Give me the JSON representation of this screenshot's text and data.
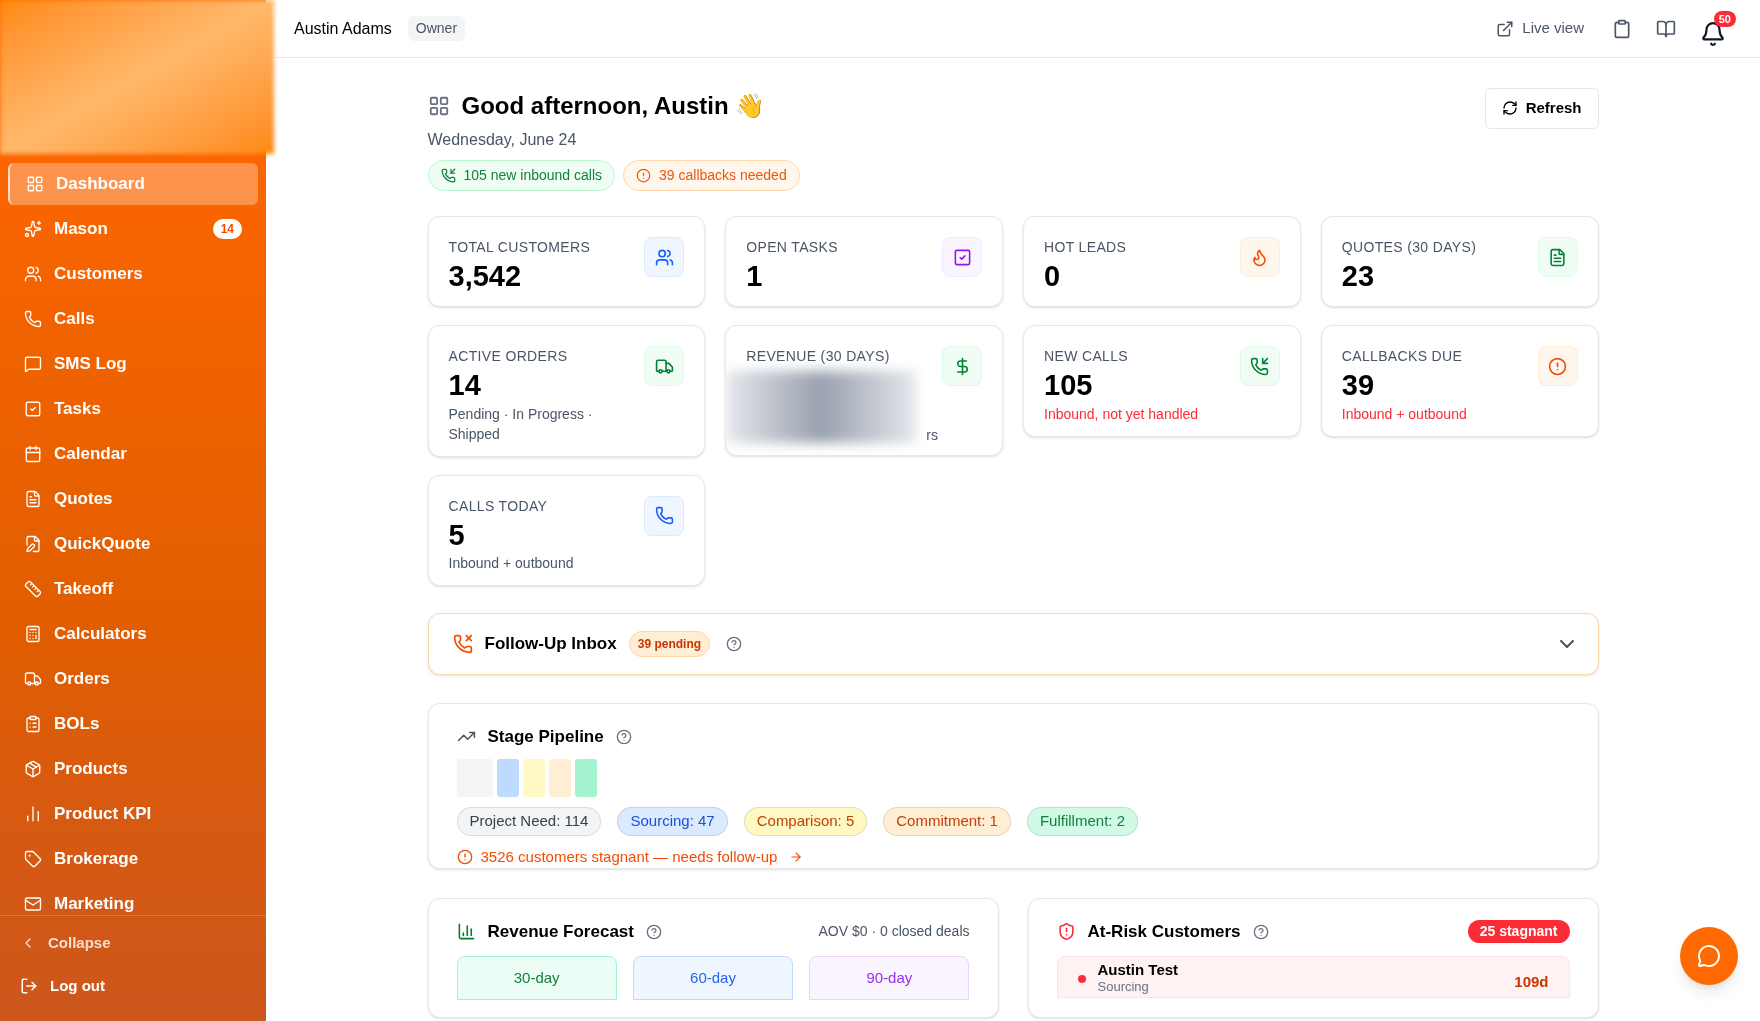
{
  "sidebar": {
    "items": [
      {
        "label": "Dashboard",
        "selected": true
      },
      {
        "label": "Mason",
        "selected": false,
        "badge": "14"
      },
      {
        "label": "Customers",
        "selected": false
      },
      {
        "label": "Calls",
        "selected": false
      },
      {
        "label": "SMS Log",
        "selected": false
      },
      {
        "label": "Tasks",
        "selected": false
      },
      {
        "label": "Calendar",
        "selected": false
      },
      {
        "label": "Quotes",
        "selected": false
      },
      {
        "label": "QuickQuote",
        "selected": false
      },
      {
        "label": "Takeoff",
        "selected": false
      },
      {
        "label": "Calculators",
        "selected": false
      },
      {
        "label": "Orders",
        "selected": false
      },
      {
        "label": "BOLs",
        "selected": false
      },
      {
        "label": "Products",
        "selected": false
      },
      {
        "label": "Product KPI",
        "selected": false
      },
      {
        "label": "Brokerage",
        "selected": false
      },
      {
        "label": "Marketing",
        "selected": false
      }
    ],
    "collapse": "Collapse",
    "logout": "Log out"
  },
  "header": {
    "user": "Austin Adams",
    "role": "Owner",
    "live_view": "Live view",
    "notifications": "50"
  },
  "greeting": {
    "title": "Good afternoon, Austin 👋",
    "date": "Wednesday, June 24",
    "refresh": "Refresh",
    "pills": [
      {
        "label": "105 new inbound calls",
        "color": "#15803d"
      },
      {
        "label": "39 callbacks needed",
        "color": "#ea580c"
      }
    ]
  },
  "stats": [
    {
      "label": "TOTAL CUSTOMERS",
      "value": "3,542",
      "kind": "plain"
    },
    {
      "label": "OPEN TASKS",
      "value": "1",
      "kind": "plain"
    },
    {
      "label": "HOT LEADS",
      "value": "0",
      "kind": "plain"
    },
    {
      "label": "QUOTES (30 DAYS)",
      "value": "23",
      "kind": "plain"
    },
    {
      "label": "ACTIVE ORDERS",
      "value": "14",
      "subtitle": "Pending · In Progress · Shipped",
      "kind": "plain"
    },
    {
      "label": "REVENUE (30 DAYS)",
      "subtitle": "rs",
      "kind": "redacted"
    },
    {
      "label": "NEW CALLS",
      "value": "105",
      "subtitle": "Inbound, not yet handled",
      "kind": "alert"
    },
    {
      "label": "CALLBACKS DUE",
      "value": "39",
      "subtitle": "Inbound + outbound",
      "kind": "alert"
    },
    {
      "label": "CALLS TODAY",
      "value": "5",
      "subtitle": "Inbound + outbound",
      "kind": "plain"
    }
  ],
  "follow_up": {
    "title": "Follow-Up Inbox",
    "badge": "39 pending",
    "expanded": false
  },
  "pipeline": {
    "title": "Stage Pipeline",
    "stages": [
      {
        "label": "Project Need: 114",
        "color": "#374151"
      },
      {
        "label": "Sourcing: 47",
        "color": "#1d4ed8"
      },
      {
        "label": "Comparison: 5",
        "color": "#c2410c"
      },
      {
        "label": "Commitment: 1",
        "color": "#c2410c"
      },
      {
        "label": "Fulfillment: 2",
        "color": "#15803d"
      }
    ],
    "warning": "3526 customers stagnant — needs follow-up"
  },
  "revenue_forecast": {
    "title": "Revenue Forecast",
    "summary": "AOV $0 · 0 closed deals",
    "tabs": [
      {
        "label": "30-day",
        "color": "#15803d"
      },
      {
        "label": "60-day",
        "color": "#2563eb"
      },
      {
        "label": "90-day",
        "color": "#9333ea"
      }
    ]
  },
  "at_risk": {
    "title": "At-Risk Customers",
    "badge": "25 stagnant",
    "rows": [
      {
        "name": "Austin Test",
        "stage": "Sourcing",
        "age": "109d"
      }
    ]
  }
}
